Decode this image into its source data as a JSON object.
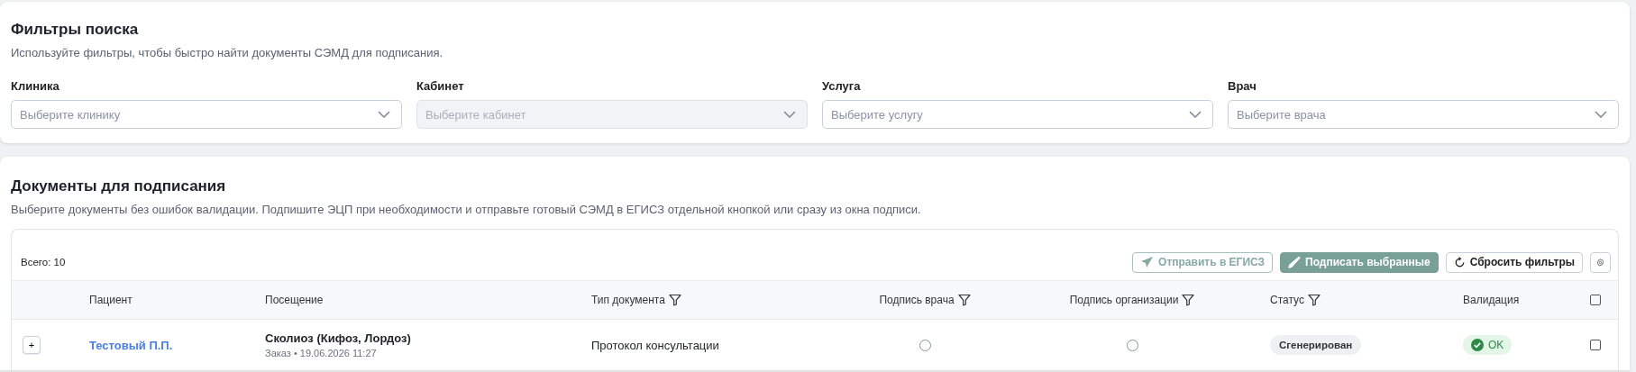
{
  "filters": {
    "title": "Фильтры поиска",
    "description": "Используйте фильтры, чтобы быстро найти документы СЭМД для подписания.",
    "fields": [
      {
        "label": "Клиника",
        "placeholder": "Выберите клинику",
        "disabled": false
      },
      {
        "label": "Кабинет",
        "placeholder": "Выберите кабинет",
        "disabled": true
      },
      {
        "label": "Услуга",
        "placeholder": "Выберите услугу",
        "disabled": false
      },
      {
        "label": "Врач",
        "placeholder": "Выберите врача",
        "disabled": false
      }
    ]
  },
  "documents": {
    "title": "Документы для подписания",
    "description": "Выберите документы без ошибок валидации. Подпишите ЭЦП при необходимости и отправьте готовый СЭМД в ЕГИСЗ отдельной кнопкой или сразу из окна подписи.",
    "total": "Всего: 10",
    "buttons": [
      {
        "label": "Отправить в ЕГИСЗ",
        "kind": "outline",
        "disabled": true
      },
      {
        "label": "Подписать выбранные",
        "kind": "primary",
        "disabled": false
      },
      {
        "label": "Сбросить фильтры",
        "kind": "default",
        "disabled": false
      }
    ],
    "table": {
      "select_all": false,
      "columns": [
        {
          "label": "Пациент",
          "filter": false
        },
        {
          "label": "Посещение",
          "filter": false
        },
        {
          "label": "Тип документа",
          "filter": true
        },
        {
          "label": "Подпись врача",
          "filter": true
        },
        {
          "label": "Подпись организации",
          "filter": true
        },
        {
          "label": "Статус",
          "filter": true
        },
        {
          "label": "Валидация",
          "filter": false
        }
      ],
      "rows": [
        {
          "expand": "+",
          "patient": "Тестовый П.П.",
          "visit": "Сколиоз (Кифоз, Лордоз)",
          "visit_meta": "Заказ • 19.06.2026 11:27",
          "doc_type": "Протокол консультации",
          "doctor_signed": false,
          "org_signed": false,
          "status": "Сгенерирован",
          "validation": "OK",
          "valid": true,
          "checked": false
        }
      ]
    }
  }
}
